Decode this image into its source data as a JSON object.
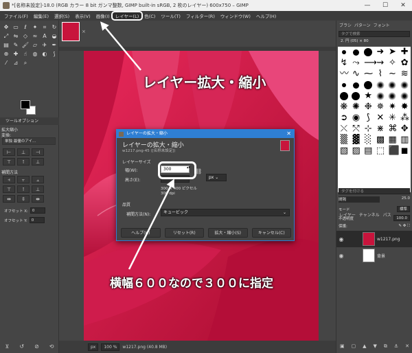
{
  "window": {
    "title": "*[名称未設定]-18.0 (RGB カラー 8 bit ガンマ整数, GIMP built-in sRGB, 2 枚のレイヤー) 600x750 – GIMP",
    "minimize": "—",
    "maximize": "☐",
    "close": "✕"
  },
  "menubar": {
    "items": [
      "ファイル(F)",
      "編集(E)",
      "選択(S)",
      "表示(V)",
      "画像(I)",
      "レイヤー(L)",
      "色(C)",
      "ツール(T)",
      "フィルター(R)",
      "ウィンドウ(W)",
      "ヘルプ(H)"
    ],
    "active_index": 5
  },
  "toolbox": {
    "tab_label": "ツールオプション",
    "section_title": "拡大縮小",
    "transform_label": "変換:",
    "transform_value": "単独 最優のアイ…",
    "interp_label": "補間方法",
    "offset_x_label": "オフセット X:",
    "offset_x_value": "0",
    "offset_y_label": "オフセット Y:",
    "offset_y_value": "0"
  },
  "image": {
    "tab_close": "×"
  },
  "statusbar": {
    "unit": "px",
    "zoom": "100 %",
    "file_info": "w1217.png (40.8 MB)"
  },
  "dock": {
    "tabs": [
      "ブラシ",
      "パターン",
      "フォント"
    ],
    "filter_placeholder": "タグで検索",
    "brush_name": "2. 円 (05) × 80",
    "brush_tag_placeholder": "タグを付ける",
    "spacing_label": "間隔",
    "spacing_value": "25.0",
    "layers_tabs": [
      "レイヤー",
      "チャンネル",
      "パス"
    ],
    "mode_label": "モード",
    "mode_value": "標準",
    "opacity_label": "不透明度",
    "opacity_value": "100.0",
    "lock_label": "保護:",
    "layers": [
      {
        "name": "w1217.png",
        "selected": true,
        "thumb_color": "#c8143c"
      },
      {
        "name": "背景",
        "selected": false,
        "thumb_color": "#ffffff"
      }
    ]
  },
  "dialog": {
    "title": "レイヤーの拡大・縮小",
    "heading": "レイヤーの拡大・縮小",
    "subtitle": "w1217.png-45 ([名称未設定])",
    "size_section": "レイヤーサイズ",
    "width_label": "幅(W):",
    "width_value": "300",
    "height_label": "高さ(E):",
    "height_value": "",
    "unit_value": "px",
    "size_info": "300 × 400 ピクセル",
    "dpi_info": "300 dpi",
    "quality_section": "品質",
    "interp_label": "補間方法(N):",
    "interp_value": "キュービック",
    "help_button": "ヘルプ(H)",
    "reset_button": "リセット(R)",
    "scale_button": "拡大・縮小(S)",
    "cancel_button": "キャンセル(C)"
  },
  "annotations": {
    "menu_callout": "レイヤー拡大・縮小",
    "width_callout": "横幅６００なので３００に指定"
  },
  "colors": {
    "accent": "#2f7fd3",
    "petal": "#c8143c"
  }
}
